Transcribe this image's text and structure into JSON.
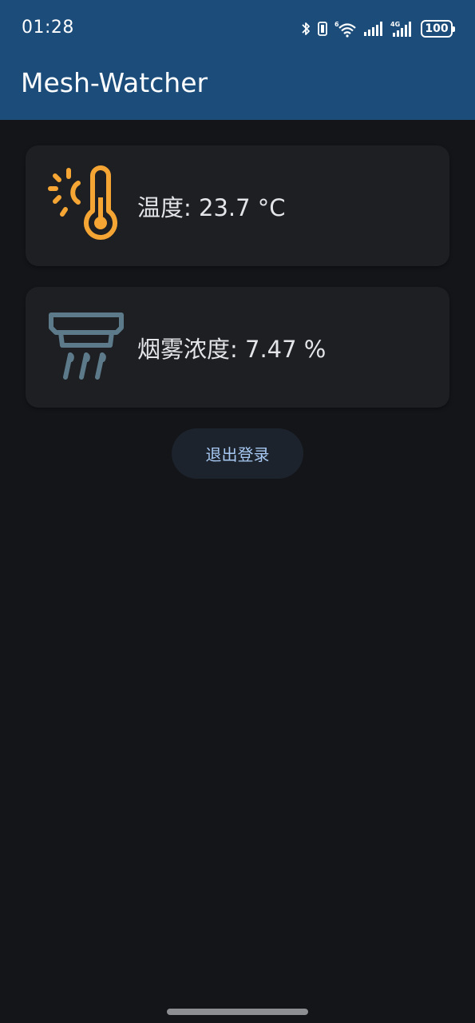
{
  "status_bar": {
    "time": "01:28",
    "network_label": "4G",
    "wifi_label": "6",
    "battery": "100",
    "icons": [
      "bluetooth-icon",
      "vibrate-icon",
      "wifi-icon",
      "signal-icon",
      "signal-4g-icon",
      "battery-icon"
    ]
  },
  "app_bar": {
    "title": "Mesh-Watcher"
  },
  "cards": {
    "temperature": {
      "icon": "thermometer-sun-icon",
      "text": "温度: 23.7 °C",
      "accent": "#f5a533"
    },
    "smoke": {
      "icon": "smoke-detector-icon",
      "text": "烟雾浓度: 7.47 %",
      "accent": "#5d7a8a"
    }
  },
  "actions": {
    "logout_label": "退出登录"
  },
  "colors": {
    "app_bar": "#1b4c7a",
    "background": "#131519",
    "card": "#1d1f23",
    "button_text": "#a6c8f2"
  }
}
